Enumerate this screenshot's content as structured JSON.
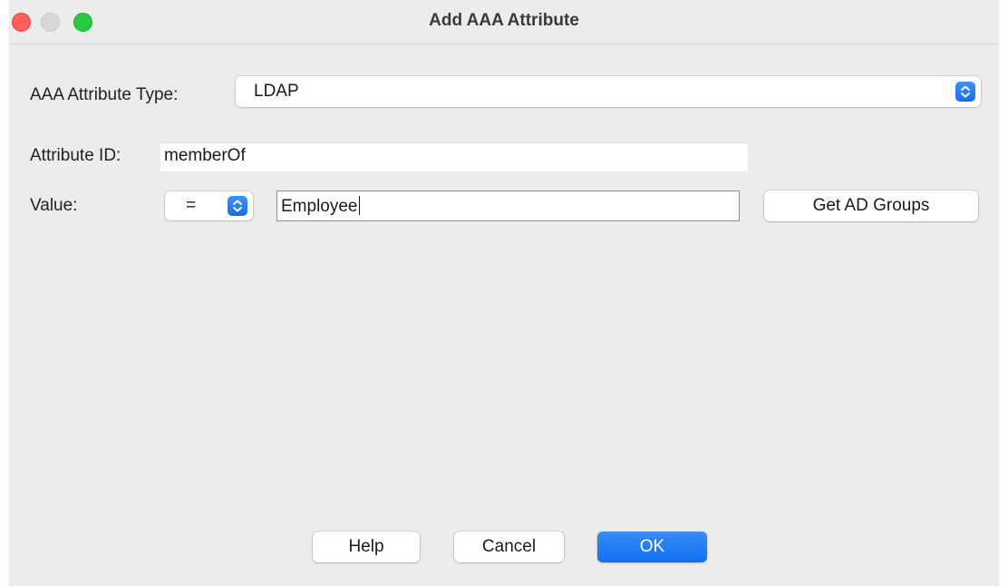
{
  "window": {
    "title": "Add AAA Attribute"
  },
  "form": {
    "attribute_type": {
      "label": "AAA Attribute Type:",
      "selected": "LDAP"
    },
    "attribute_id": {
      "label": "Attribute ID:",
      "value": "memberOf"
    },
    "value_row": {
      "label": "Value:",
      "operator": "=",
      "value": "Employee",
      "get_groups_label": "Get AD Groups"
    }
  },
  "buttons": {
    "help": "Help",
    "cancel": "Cancel",
    "ok": "OK"
  },
  "colors": {
    "accent": "#1a6fe6",
    "close": "#fe5f57",
    "maximize": "#28c840"
  },
  "icons": {
    "stepper": "up-down-chevron-icon"
  }
}
